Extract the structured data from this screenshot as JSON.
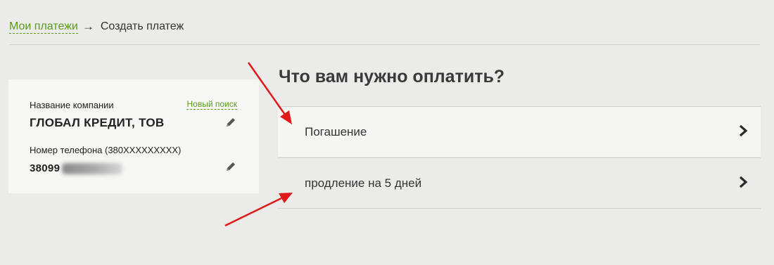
{
  "breadcrumb": {
    "link_label": "Мои платежи",
    "separator": "→",
    "current": "Создать платеж"
  },
  "company_card": {
    "company_label": "Название компании",
    "company_value": "ГЛОБАЛ КРЕДИТ, ТОВ",
    "new_search_label": "Новый поиск",
    "phone_label": "Номер телефона (380XXXXXXXXX)",
    "phone_value": "38099"
  },
  "main": {
    "question": "Что вам нужно оплатить?",
    "options": [
      {
        "label": "Погашение",
        "icon": "chevron-right-icon"
      },
      {
        "label": "продление на 5 дней",
        "icon": "chevron-right-icon"
      }
    ]
  },
  "colors": {
    "accent": "#5a9a1c",
    "annotation_arrow": "#e0191b",
    "background": "#ebebea",
    "card": "#f6f6f5"
  }
}
